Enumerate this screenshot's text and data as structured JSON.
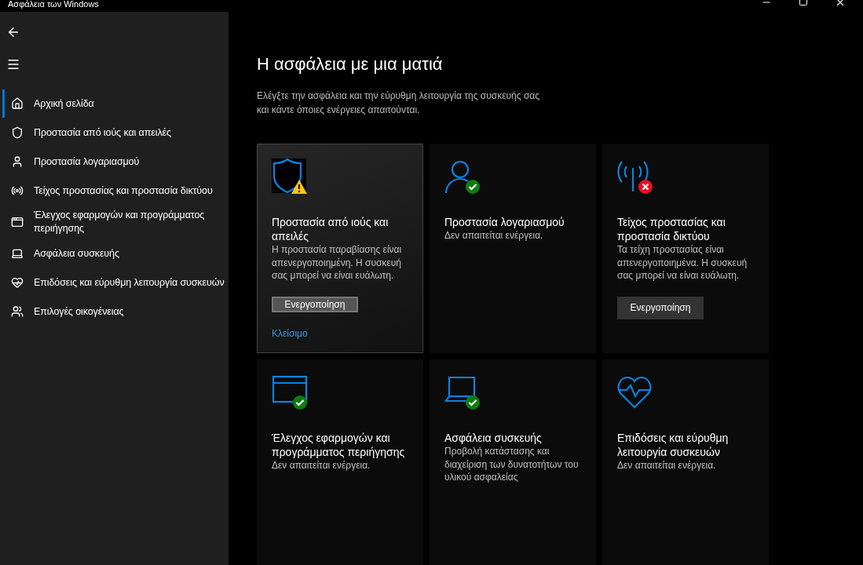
{
  "window": {
    "title": "Ασφάλεια των Windows"
  },
  "sidebar": {
    "items": [
      {
        "label": "Αρχική σελίδα",
        "selected": true
      },
      {
        "label": "Προστασία από ιούς και απειλές",
        "selected": false
      },
      {
        "label": "Προστασία λογαριασμού",
        "selected": false
      },
      {
        "label": "Τείχος προστασίας και προστασία δικτύου",
        "selected": false
      },
      {
        "label": "Έλεγχος εφαρμογών και προγράμματος περιήγησης",
        "selected": false
      },
      {
        "label": "Ασφάλεια συσκευής",
        "selected": false
      },
      {
        "label": "Επιδόσεις και εύρυθμη λειτουργία συσκευών",
        "selected": false
      },
      {
        "label": "Επιλογές οικογένειας",
        "selected": false
      }
    ]
  },
  "main": {
    "heading": "Η ασφάλεια με μια ματιά",
    "description": "Ελέγξτε την ασφάλεια και την εύρυθμη λειτουργία της συσκευής σας και κάντε όποιες ενέργειες απαιτούνται.",
    "cards": [
      {
        "title": "Προστασία από ιούς και απειλές",
        "description": "Η προστασία παραβίασης είναι απενεργοποιημένη. Η συσκευή σας μπορεί να είναι ευάλωτη.",
        "kind": "warning",
        "highlighted": true,
        "button": "Ενεργοποίηση",
        "link": "Κλείσιμο"
      },
      {
        "title": "Προστασία λογαριασμού",
        "description": "Δεν απαιτείται ενέργεια.",
        "kind": "ok",
        "highlighted": false
      },
      {
        "title": "Τείχος προστασίας και προστασία δικτύου",
        "description": "Τα τείχη προστασίας είναι απενεργοποιημένα. Η συσκευή σας μπορεί να είναι ευάλωτη.",
        "kind": "error",
        "highlighted": false,
        "button": "Ενεργοποίηση"
      },
      {
        "title": "Έλεγχος εφαρμογών και προγράμματος περιήγησης",
        "description": "Δεν απαιτείται ενέργεια.",
        "kind": "ok",
        "highlighted": false
      },
      {
        "title": "Ασφάλεια συσκευής",
        "description": "Προβολή κατάστασης και διαχείριση των δυνατοτήτων του υλικού ασφαλείας",
        "kind": "ok",
        "highlighted": false
      },
      {
        "title": "Επιδόσεις και εύρυθμη λειτουργία συσκευών",
        "description": "Δεν απαιτείται ενέργεια.",
        "kind": "plain",
        "highlighted": false
      }
    ]
  }
}
